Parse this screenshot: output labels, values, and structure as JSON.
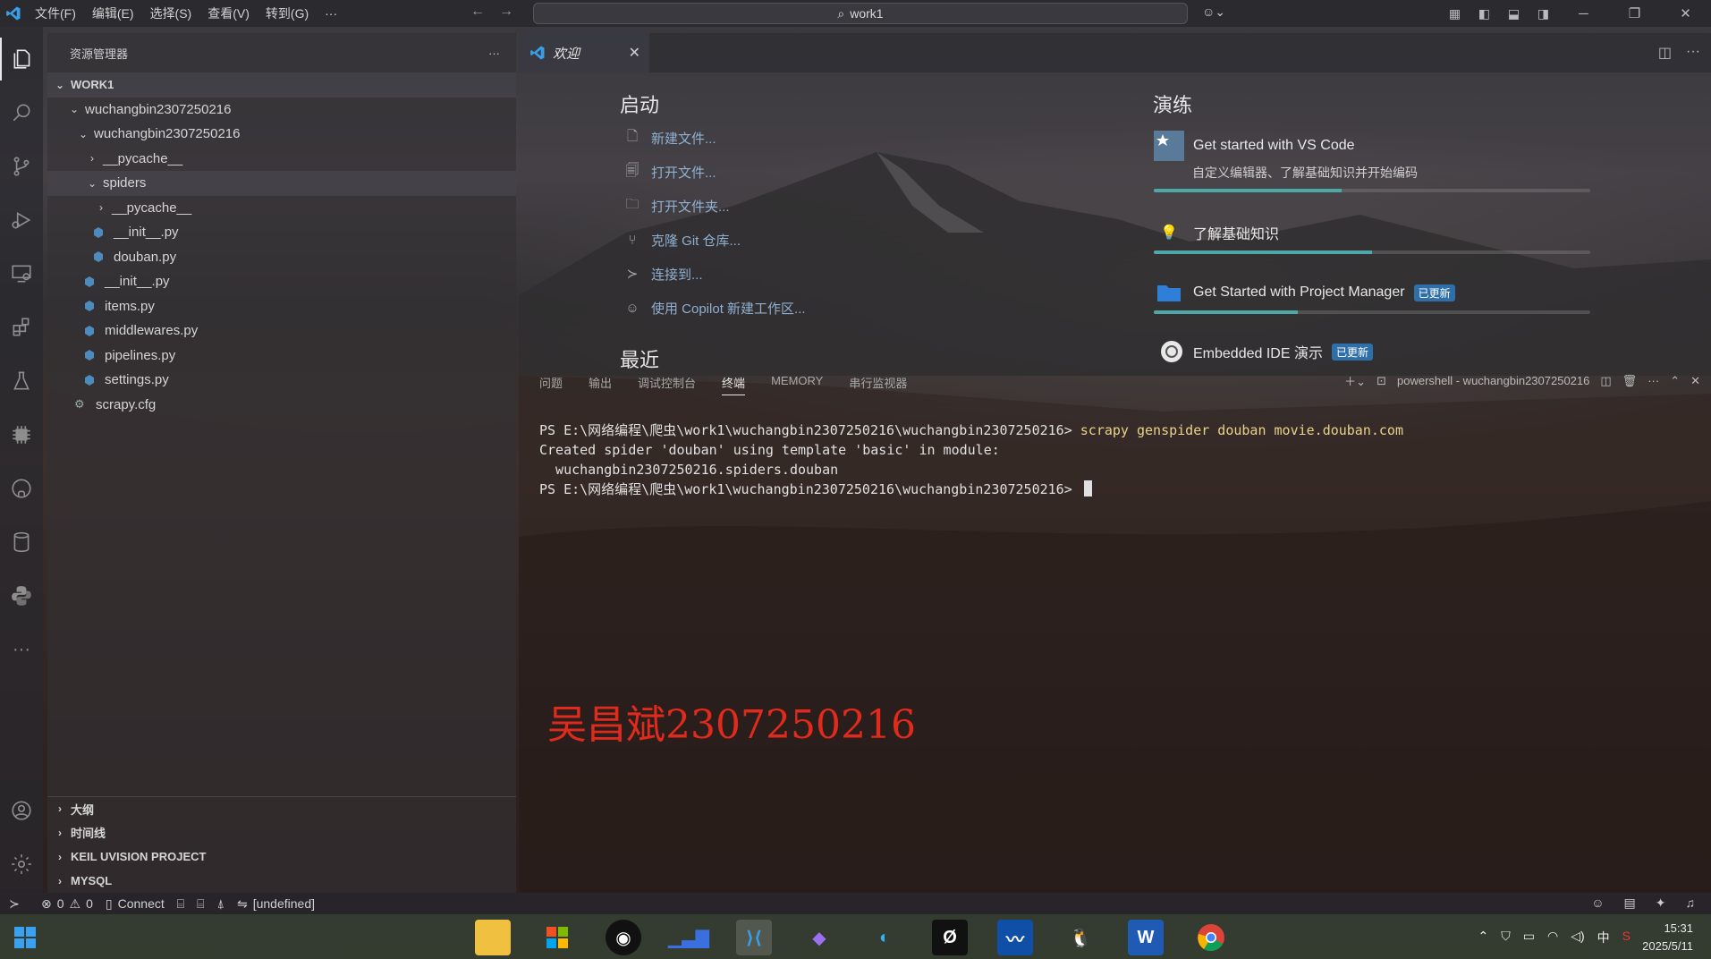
{
  "titlebar": {
    "menus": [
      "文件(F)",
      "编辑(E)",
      "选择(S)",
      "查看(V)",
      "转到(G)",
      "···"
    ],
    "search_text": "work1"
  },
  "sidebar": {
    "title": "资源管理器",
    "more": "···",
    "workspace": "WORK1",
    "tree": [
      {
        "label": "wuchangbin2307250216",
        "kind": "folder-open"
      },
      {
        "label": "wuchangbin2307250216",
        "kind": "folder-open"
      },
      {
        "label": "__pycache__",
        "kind": "folder-closed"
      },
      {
        "label": "spiders",
        "kind": "folder-open"
      },
      {
        "label": "__pycache__",
        "kind": "folder-closed"
      },
      {
        "label": "__init__.py",
        "kind": "python-file"
      },
      {
        "label": "douban.py",
        "kind": "python-file"
      },
      {
        "label": "__init__.py",
        "kind": "python-file"
      },
      {
        "label": "items.py",
        "kind": "python-file"
      },
      {
        "label": "middlewares.py",
        "kind": "python-file"
      },
      {
        "label": "pipelines.py",
        "kind": "python-file"
      },
      {
        "label": "settings.py",
        "kind": "python-file"
      },
      {
        "label": "scrapy.cfg",
        "kind": "gear-file"
      }
    ],
    "sections": [
      "大纲",
      "时间线",
      "KEIL UVISION PROJECT",
      "MYSQL"
    ]
  },
  "editor": {
    "tab_label": "欢迎",
    "close": "✕"
  },
  "welcome": {
    "start_title": "启动",
    "start_items": [
      "新建文件...",
      "打开文件...",
      "打开文件夹...",
      "克隆 Git 仓库...",
      "连接到...",
      "使用 Copilot 新建工作区..."
    ],
    "recent_title": "最近",
    "walk_title": "演练",
    "walkthroughs": [
      {
        "title": "Get started with VS Code",
        "subtitle": "自定义编辑器、了解基础知识并开始编码",
        "progress": 0.43,
        "badge": ""
      },
      {
        "title": "了解基础知识",
        "subtitle": "",
        "progress": 0.5,
        "badge": ""
      },
      {
        "title": "Get Started with Project Manager",
        "subtitle": "",
        "progress": 0.33,
        "badge": "已更新"
      },
      {
        "title": "Embedded IDE 演示",
        "subtitle": "",
        "progress": 0,
        "badge": "已更新"
      }
    ]
  },
  "panel": {
    "tabs": [
      "问题",
      "输出",
      "调试控制台",
      "终端",
      "MEMORY",
      "串行监视器"
    ],
    "active_tab": "终端",
    "shell_label": "powershell - wuchangbin2307250216",
    "terminal": {
      "prompt1": "PS E:\\网络编程\\爬虫\\work1\\wuchangbin2307250216\\wuchangbin2307250216> ",
      "command1": "scrapy genspider douban movie.douban.com",
      "output1": "Created spider 'douban' using template 'basic' in module:",
      "output2": "  wuchangbin2307250216.spiders.douban",
      "prompt2": "PS E:\\网络编程\\爬虫\\work1\\wuchangbin2307250216\\wuchangbin2307250216> "
    }
  },
  "watermark": "吴昌斌2307250216",
  "statusbar": {
    "errors": "0",
    "warnings": "0",
    "connect": "Connect",
    "undefined": "[undefined]"
  },
  "taskbar": {
    "time": "15:31",
    "date": "2025/5/11",
    "ime": "中"
  }
}
